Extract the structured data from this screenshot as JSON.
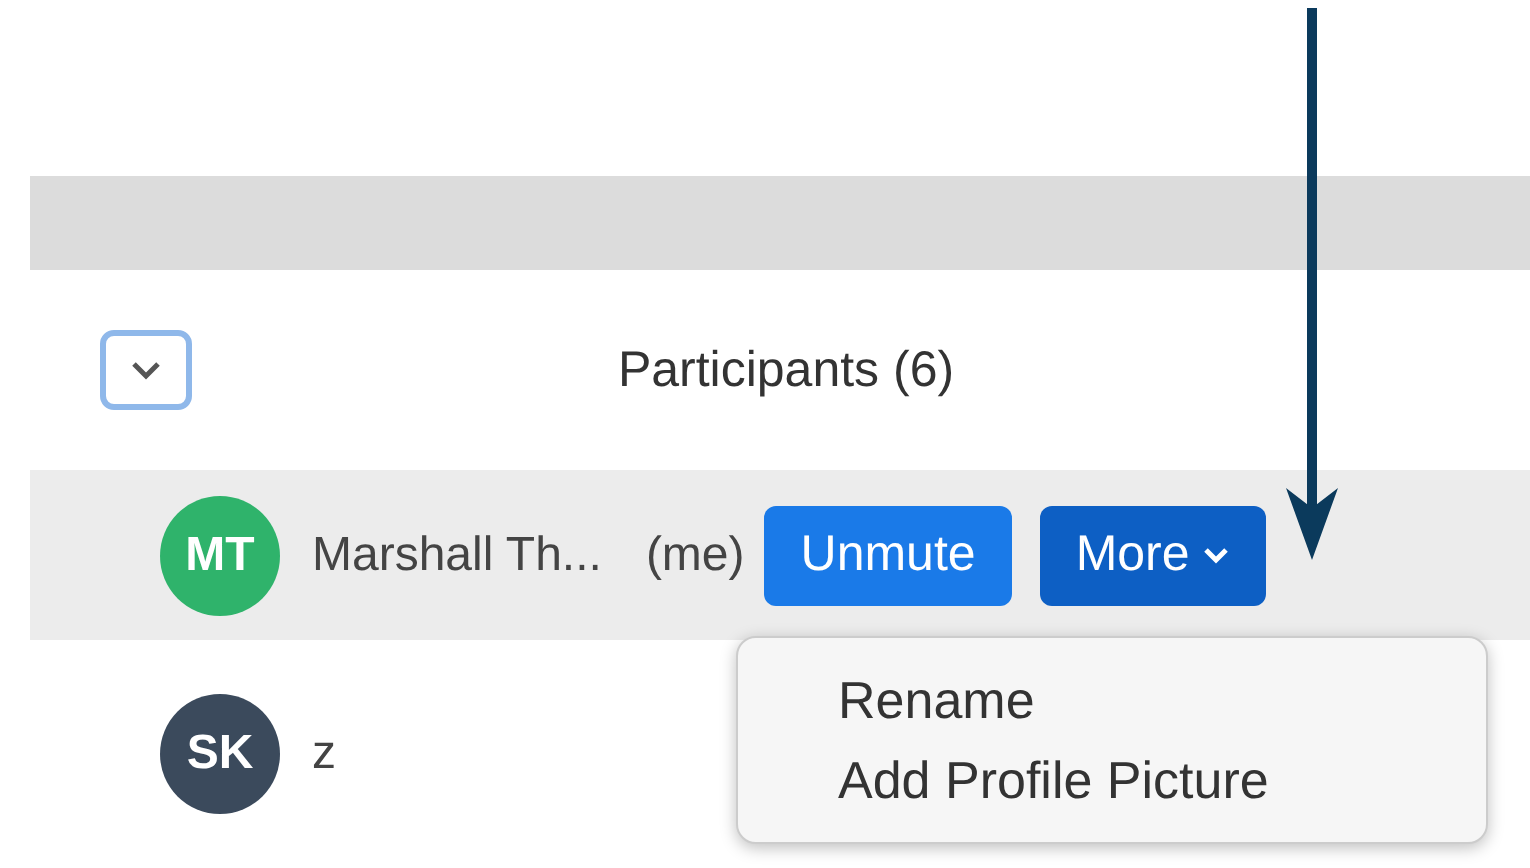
{
  "title": "Participants (6)",
  "participants": [
    {
      "initials": "MT",
      "color": "#2fb36b",
      "name": "Marshall Th...",
      "tag": "(me)",
      "selected": true,
      "buttons": [
        {
          "label": "Unmute",
          "kind": "primary"
        },
        {
          "label": "More",
          "kind": "menu"
        }
      ]
    },
    {
      "initials": "SK",
      "color": "#3b4a5c",
      "name": "z",
      "selected": false
    }
  ],
  "menu": {
    "items": [
      "Rename",
      "Add Profile Picture"
    ]
  }
}
